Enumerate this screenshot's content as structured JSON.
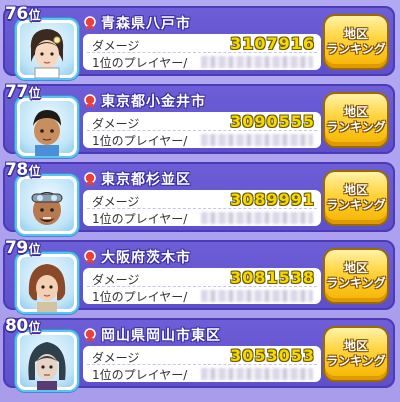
{
  "rows": [
    {
      "rank": "76",
      "rank_suffix": "位",
      "region": "青森県八戸市",
      "damage_label": "ダメージ",
      "damage": "3107916",
      "player_label": "1位のプレイヤー/",
      "button_line1": "地区",
      "button_line2": "ランキング",
      "avatar_icon": "girl-short-hair-avatar",
      "medal_icon": "red-medal-icon"
    },
    {
      "rank": "77",
      "rank_suffix": "位",
      "region": "東京都小金井市",
      "damage_label": "ダメージ",
      "damage": "3090555",
      "player_label": "1位のプレイヤー/",
      "button_line1": "地区",
      "button_line2": "ランキング",
      "avatar_icon": "boy-dark-hair-avatar",
      "medal_icon": "red-medal-icon"
    },
    {
      "rank": "78",
      "rank_suffix": "位",
      "region": "東京都杉並区",
      "damage_label": "ダメージ",
      "damage": "3089991",
      "player_label": "1位のプレイヤー/",
      "button_line1": "地区",
      "button_line2": "ランキング",
      "avatar_icon": "goggles-man-avatar",
      "medal_icon": "red-medal-icon"
    },
    {
      "rank": "79",
      "rank_suffix": "位",
      "region": "大阪府茨木市",
      "damage_label": "ダメージ",
      "damage": "3081538",
      "player_label": "1位のプレイヤー/",
      "button_line1": "地区",
      "button_line2": "ランキング",
      "avatar_icon": "woman-brown-hair-avatar",
      "medal_icon": "red-medal-icon"
    },
    {
      "rank": "80",
      "rank_suffix": "位",
      "region": "岡山県岡山市東区",
      "damage_label": "ダメージ",
      "damage": "3053053",
      "player_label": "1位のプレイヤー/",
      "button_line1": "地区",
      "button_line2": "ランキング",
      "avatar_icon": "dark-haired-girl-avatar",
      "medal_icon": "red-medal-icon"
    }
  ],
  "colors": {
    "card": "#5d4ecb",
    "background": "#ad a2ee",
    "damage": "#f7d800",
    "button": "#ffd23a",
    "avatar_border": "#5fc3f2"
  }
}
